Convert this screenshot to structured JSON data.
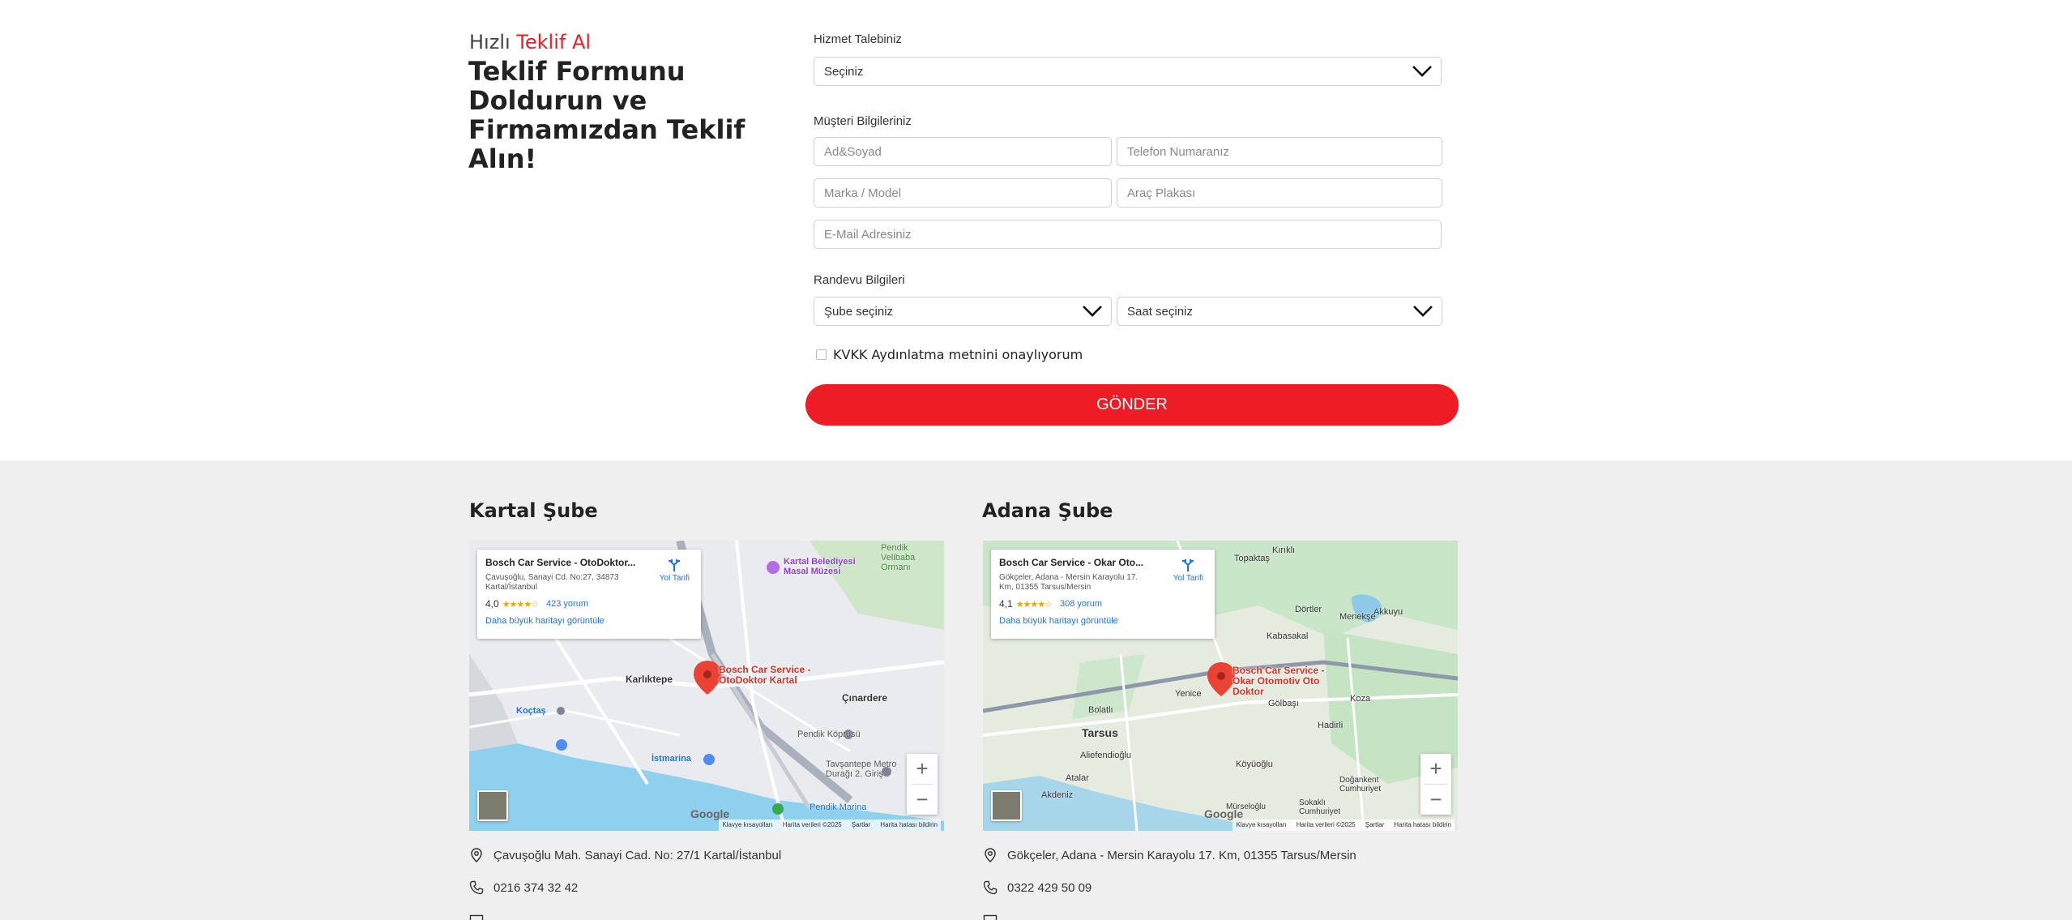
{
  "form": {
    "kicker_plain": "Hızlı",
    "kicker_highlight": "Teklif Al",
    "title": "Teklif Formunu Doldurun ve Firmamızdan Teklif Alın!",
    "service_label": "Hizmet Talebiniz",
    "service_value": "Seçiniz",
    "customer_label": "Müşteri Bilgileriniz",
    "name_placeholder": "Ad&Soyad",
    "phone_placeholder": "Telefon Numaranız",
    "model_placeholder": "Marka / Model",
    "plate_placeholder": "Araç Plakası",
    "email_placeholder": "E-Mail Adresiniz",
    "appointment_label": "Randevu Bilgileri",
    "branch_value": "Şube seçiniz",
    "time_value": "Saat seçiniz",
    "kvkk_text": "KVKK Aydınlatma metnini onaylıyorum",
    "submit_label": "GÖNDER"
  },
  "branches": {
    "kartal": {
      "title": "Kartal Şube",
      "card_name": "Bosch Car Service - OtoDoktor...",
      "card_address": "Çavuşoğlu, Sanayi Cd. No:27, 34873 Kartal/İstanbul",
      "rating": "4,0",
      "stars": "★★★★☆",
      "reviews": "423 yorum",
      "bigger_map": "Daha büyük haritayı görüntüle",
      "directions": "Yol Tarifi",
      "pin_label": "Bosch Car Service - OtoDoktor Kartal",
      "places": [
        "Karlıktepe",
        "Çınardere",
        "Kartal Belediyesi Masal Müzesi",
        "Koçtaş",
        "İstmarina",
        "Pendik Köprüsü",
        "Tavşantepe Metro Durağı 2. Giriş",
        "Pendik Marina",
        "Pendik Velibaba Ormanı"
      ],
      "address": "Çavuşoğlu Mah. Sanayi Cad. No: 27/1 Kartal/İstanbul",
      "phone": "0216 374 32 42"
    },
    "adana": {
      "title": "Adana Şube",
      "card_name": "Bosch Car Service - Okar Oto...",
      "card_address": "Gökçeler, Adana - Mersin Karayolu 17. Km, 01355 Tarsus/Mersin",
      "rating": "4,1",
      "stars": "★★★★☆",
      "reviews": "308 yorum",
      "bigger_map": "Daha büyük haritayı görüntüle",
      "directions": "Yol Tarifi",
      "pin_label": "Bosch Car Service - Okar Otomotiv Oto Doktor",
      "places": [
        "Tarsus",
        "Yenice",
        "Bolatlı",
        "Aliefendioğlu",
        "Gölbaşı",
        "Köyüoğlu",
        "Akdeniz",
        "Atalar",
        "Kabasakal",
        "Topaktaş",
        "Menekşe",
        "Akkuyu",
        "Koza",
        "Hadirli",
        "Dörtler",
        "Kırıklı",
        "Doğankent Cumhuriyet",
        "Sokaklı Cumhuriyet",
        "Mürseloğlu"
      ],
      "address": "Gökçeler, Adana - Mersin Karayolu 17. Km, 01355 Tarsus/Mersin",
      "phone": "0322 429 50 09"
    },
    "map_attrib": [
      "Klavye kısayolları",
      "Harita verileri ©2025",
      "Şartlar",
      "Harita hatası bildirin"
    ],
    "google": "Google"
  }
}
